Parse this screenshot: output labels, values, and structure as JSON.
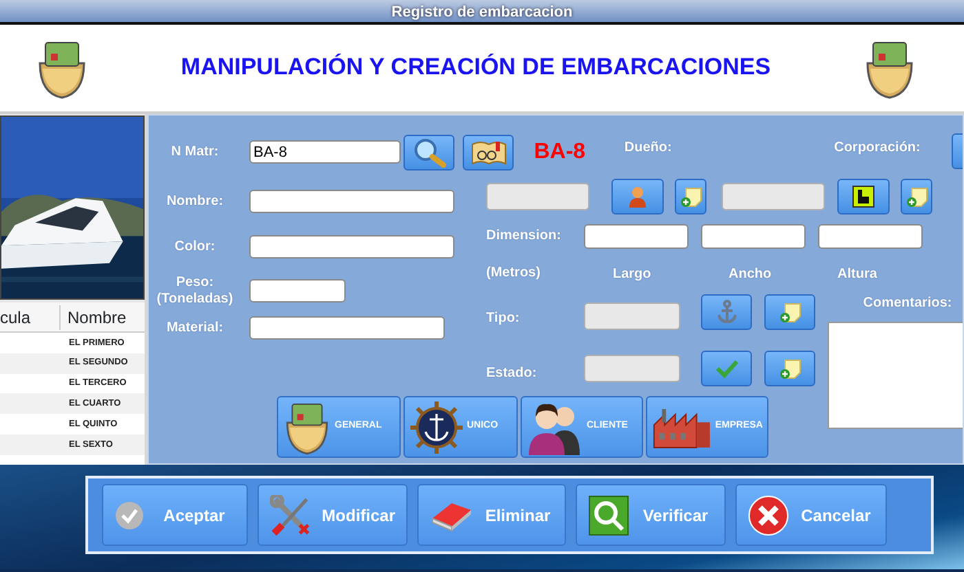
{
  "window": {
    "title": "Registro de embarcacion"
  },
  "header": {
    "title": "MANIPULACIÓN Y CREACIÓN DE EMBARCACIONES"
  },
  "list": {
    "columns": [
      "cula",
      "Nombre"
    ],
    "rows": [
      "EL PRIMERO",
      "EL SEGUNDO",
      "EL TERCERO",
      "EL CUARTO",
      "EL QUINTO",
      "EL SEXTO"
    ]
  },
  "fields": [
    {
      "label": "N Matr:",
      "value": "BA-8"
    },
    {
      "label": "Nombre:"
    },
    {
      "label": "Color:"
    },
    {
      "label": "Peso:",
      "sublabel": "(Toneladas)"
    },
    {
      "label": "Material:"
    }
  ],
  "record_code": "BA-8",
  "lookups": [
    {
      "label": "Dueño:",
      "disabled": true,
      "kind": "person"
    },
    {
      "label": "Corporación:",
      "disabled": true,
      "kind": "building"
    }
  ],
  "dimension": {
    "label": "Dimension:",
    "unit": "(Metros)",
    "axes": [
      "Largo",
      "Ancho",
      "Altura"
    ]
  },
  "attributes": [
    {
      "label": "Tipo:",
      "disabled": true,
      "kind": "anchor"
    },
    {
      "label": "Estado:",
      "disabled": true,
      "kind": "check"
    }
  ],
  "comments": {
    "label": "Comentarios:"
  },
  "categories": [
    {
      "label": "GENERAL",
      "kind": "boat"
    },
    {
      "label": "UNICO",
      "kind": "wheel"
    },
    {
      "label": "CLIENTE",
      "kind": "people"
    },
    {
      "label": "EMPRESA",
      "kind": "factory"
    }
  ],
  "actions": [
    {
      "label": "Aceptar",
      "kind": "accept"
    },
    {
      "label": "Modificar",
      "kind": "modify"
    },
    {
      "label": "Eliminar",
      "kind": "delete"
    },
    {
      "label": "Verificar",
      "kind": "verify"
    },
    {
      "label": "Cancelar",
      "kind": "cancel"
    }
  ]
}
